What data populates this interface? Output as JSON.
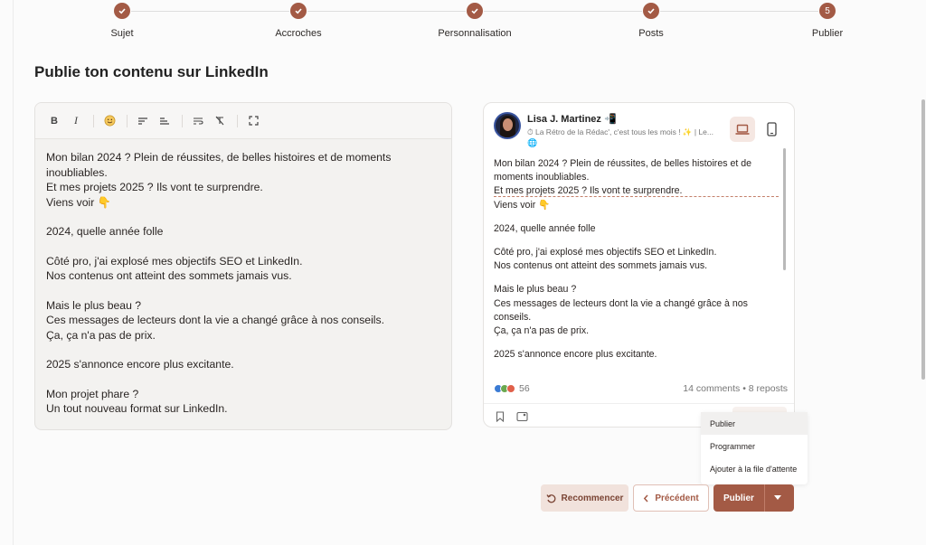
{
  "stepper": {
    "steps": [
      {
        "label": "Sujet",
        "state": "done"
      },
      {
        "label": "Accroches",
        "state": "done"
      },
      {
        "label": "Personnalisation",
        "state": "done"
      },
      {
        "label": "Posts",
        "state": "done"
      },
      {
        "label": "Publier",
        "state": "current",
        "number": "5"
      }
    ]
  },
  "page": {
    "title": "Publie ton contenu sur LinkedIn"
  },
  "editor": {
    "toolbar": [
      "bold-icon",
      "italic-icon",
      "emoji-icon",
      "align-left-icon",
      "align-short-icon",
      "wrap-text-icon",
      "clear-format-icon",
      "fullscreen-icon"
    ],
    "paragraphs": [
      "Mon bilan 2024 ? Plein de réussites, de belles histoires et de moments inoubliables.\nEt mes projets 2025 ? Ils vont te surprendre.\nViens voir 👇",
      "2024, quelle année folle",
      "Côté pro, j'ai explosé mes objectifs SEO et LinkedIn.\nNos contenus ont atteint des sommets jamais vus.",
      "Mais le plus beau ?\nCes messages de lecteurs dont la vie a changé grâce à nos conseils.\nÇa, ça n'a pas de prix.",
      "2025 s'annonce encore plus excitante.",
      "Mon projet phare ?\nUn tout nouveau format sur LinkedIn."
    ]
  },
  "preview": {
    "author_name": "Lisa J. Martinez 📲",
    "author_subtitle": "⏱ La Rétro de la Rédac', c'est tous les mois ! ✨ | Le...",
    "globe": "🌐",
    "lines_before_cut": [
      "Mon bilan 2024 ? Plein de réussites, de belles histoires et de moments inoubliables.",
      "Et mes projets 2025 ? Ils vont te surprendre."
    ],
    "after_cut": "Viens voir 👇",
    "paragraphs": [
      "2024, quelle année folle",
      "Côté pro, j'ai explosé mes objectifs SEO et LinkedIn.\nNos contenus ont atteint des sommets jamais vus.",
      "Mais le plus beau ?\nCes messages de lecteurs dont la vie a changé grâce à nos conseils.\nÇa, ça n'a pas de prix.",
      "2025 s'annonce encore plus excitante."
    ],
    "reactions_count": "56",
    "engagement": "14 comments • 8 reposts",
    "device_active": "desktop"
  },
  "dropdown": {
    "items": [
      "Publier",
      "Programmer",
      "Ajouter à la file d'attente"
    ],
    "active_index": 0
  },
  "actions": {
    "reset_label": "Recommencer",
    "prev_label": "Précédent",
    "publish_label": "Publier"
  },
  "colors": {
    "accent": "#a35a45",
    "accent_light": "#f1e2dc",
    "reset_text": "#7a4434"
  }
}
